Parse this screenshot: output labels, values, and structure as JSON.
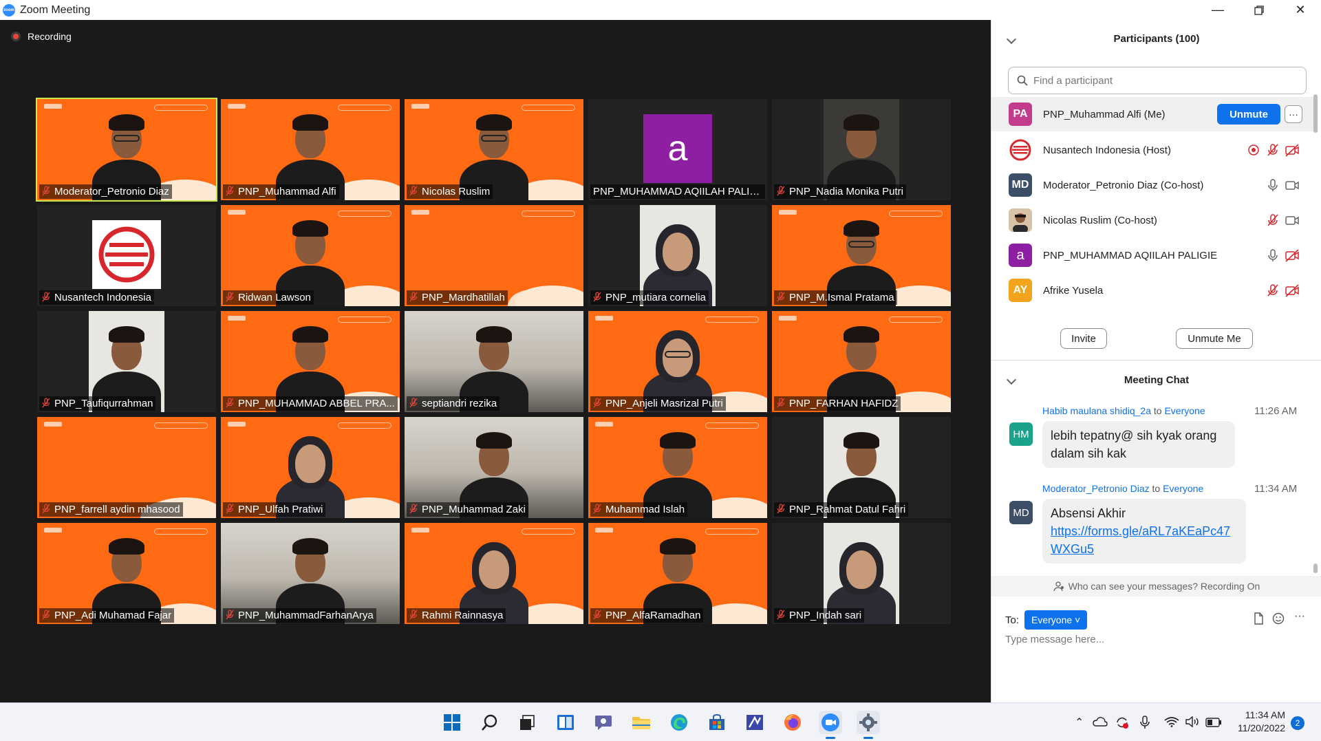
{
  "window": {
    "title": "Zoom Meeting"
  },
  "recording_label": "Recording",
  "tiles": [
    {
      "name": "Moderator_Petronio Diaz"
    },
    {
      "name": "PNP_Muhammad Alfi"
    },
    {
      "name": "Nicolas Ruslim"
    },
    {
      "name": "PNP_MUHAMMAD AQIILAH PALIG...",
      "avatar": "a"
    },
    {
      "name": "PNP_Nadia Monika Putri"
    },
    {
      "name": "Nusantech Indonesia"
    },
    {
      "name": "Ridwan Lawson"
    },
    {
      "name": "PNP_Mardhatillah"
    },
    {
      "name": "PNP_mutiara cornelia"
    },
    {
      "name": "PNP_M.Ismal Pratama"
    },
    {
      "name": "PNP_Taufiqurrahman"
    },
    {
      "name": "PNP_MUHAMMAD ABBEL PRA..."
    },
    {
      "name": "septiandri rezika"
    },
    {
      "name": "PNP_Anjeli Masrizal Putri"
    },
    {
      "name": "PNP_FARHAN HAFIDZ"
    },
    {
      "name": "PNP_farrell aydin mhasood"
    },
    {
      "name": "PNP_Ulfah Pratiwi"
    },
    {
      "name": "PNP_Muhammad Zaki"
    },
    {
      "name": "Muhammad Islah"
    },
    {
      "name": "PNP_Rahmat Datul Fahri"
    },
    {
      "name": "PNP_Adi Muhamad Fajar"
    },
    {
      "name": "PNP_MuhammadFarhanArya"
    },
    {
      "name": "Rahmi Rainnasya"
    },
    {
      "name": "PNP_AlfaRamadhan"
    },
    {
      "name": "PNP_Indah sari"
    }
  ],
  "participants_panel": {
    "title": "Participants (100)",
    "search_placeholder": "Find a participant",
    "rows": [
      {
        "initials": "PA",
        "name": "PNP_Muhammad Alfi (Me)",
        "color": "#c23b8d"
      },
      {
        "initials": "",
        "name": "Nusantech Indonesia (Host)"
      },
      {
        "initials": "MD",
        "name": "Moderator_Petronio Diaz (Co-host)",
        "color": "#3d4f66"
      },
      {
        "initials": "",
        "name": "Nicolas Ruslim (Co-host)"
      },
      {
        "initials": "a",
        "name": "PNP_MUHAMMAD AQIILAH PALIGIE",
        "color": "#8e1fa3"
      },
      {
        "initials": "AY",
        "name": "Afrike Yusela",
        "color": "#f2a41c"
      }
    ],
    "unmute_label": "Unmute",
    "more_label": "···",
    "invite_label": "Invite",
    "unmute_me_label": "Unmute Me"
  },
  "chat": {
    "title": "Meeting Chat",
    "messages": [
      {
        "initials": "HM",
        "color": "#1aa38a",
        "sender": "Habib maulana shidiq_2a",
        "to_word": "to",
        "recipient": "Everyone",
        "time": "11:26 AM",
        "text": "lebih tepatny@ sih kyak orang dalam sih kak"
      },
      {
        "initials": "MD",
        "color": "#3d4f66",
        "sender": "Moderator_Petronio Diaz",
        "to_word": "to",
        "recipient": "Everyone",
        "time": "11:34 AM",
        "text": "Absensi Akhir",
        "link": "https://forms.gle/aRL7aKEaPc47WXGu5"
      }
    ],
    "notice": "Who can see your messages? Recording On",
    "to_label": "To:",
    "recipient_select": "Everyone",
    "input_placeholder": "Type message here...",
    "more_label": "···"
  },
  "taskbar": {
    "time": "11:34 AM",
    "date": "11/20/2022",
    "notification_count": "2"
  }
}
